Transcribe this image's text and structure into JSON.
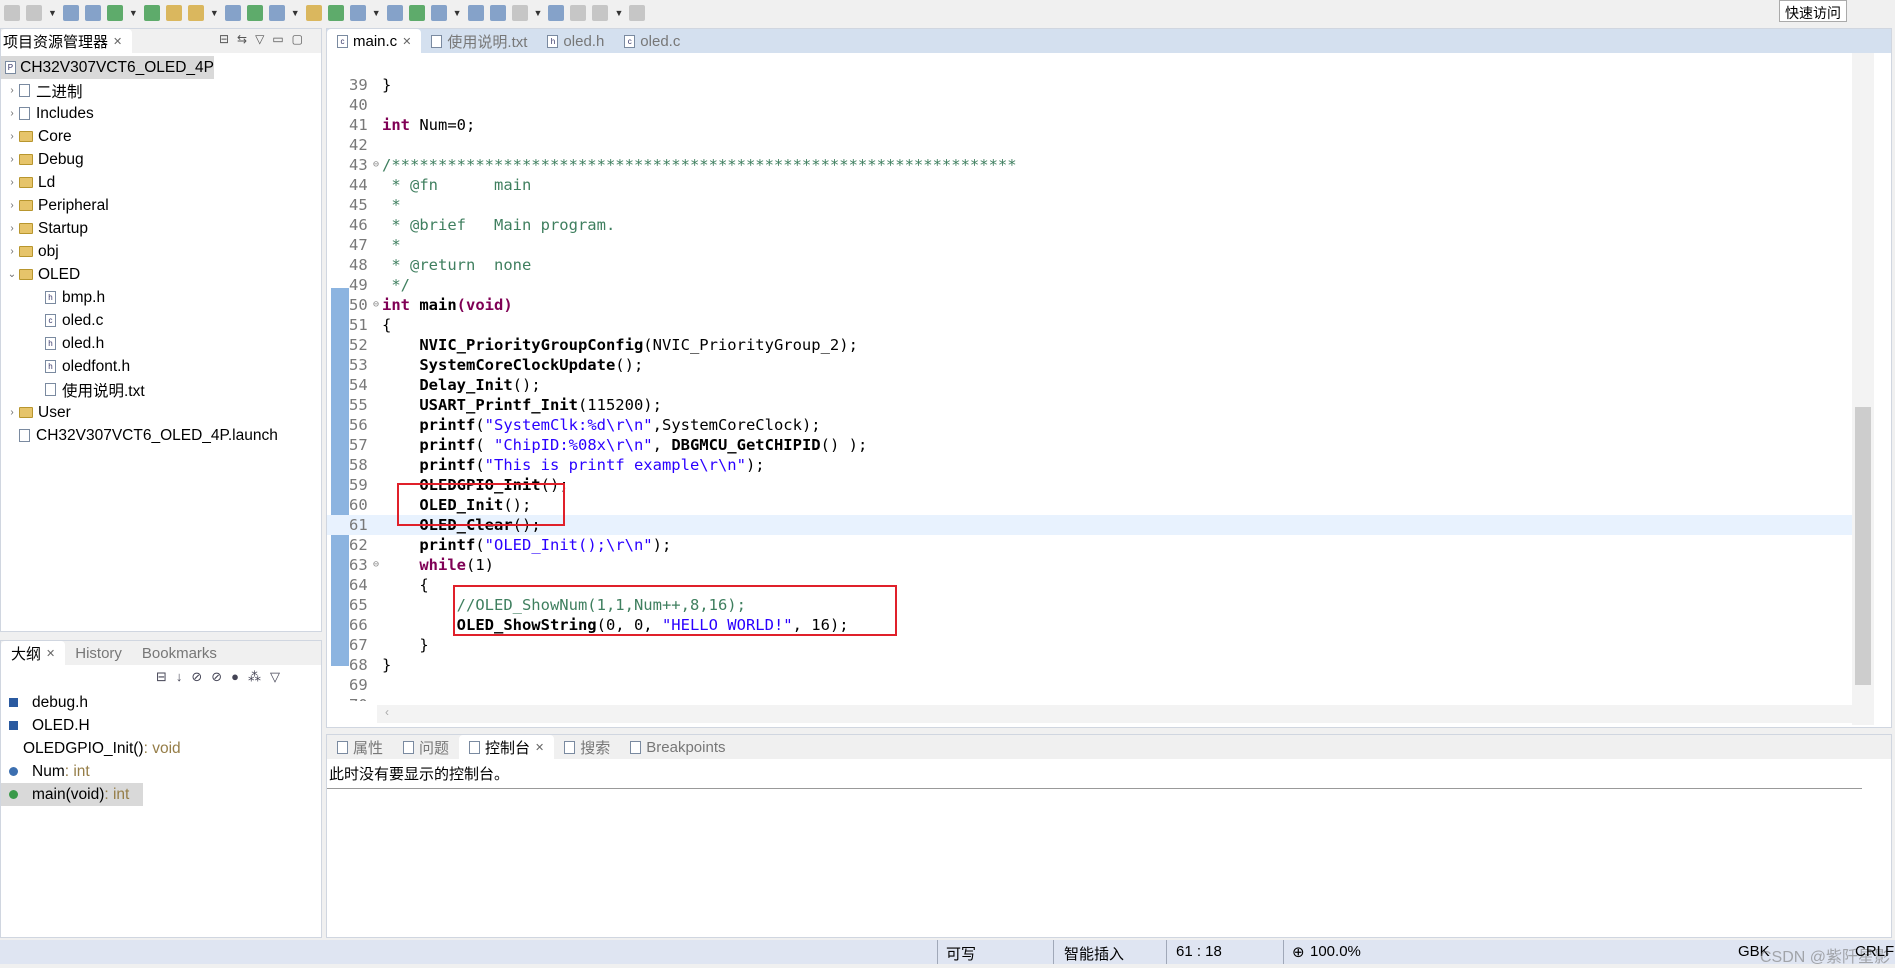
{
  "toolbar": {
    "quick_access": "快速访问"
  },
  "explorer": {
    "title": "项目资源管理器",
    "project": "CH32V307VCT6_OLED_4P",
    "items": [
      {
        "label": "二进制",
        "type": "binary",
        "expandable": true
      },
      {
        "label": "Includes",
        "type": "includes",
        "expandable": true
      },
      {
        "label": "Core",
        "type": "folder",
        "expandable": true
      },
      {
        "label": "Debug",
        "type": "folder",
        "expandable": true
      },
      {
        "label": "Ld",
        "type": "folder",
        "expandable": true
      },
      {
        "label": "Peripheral",
        "type": "folder",
        "expandable": true
      },
      {
        "label": "Startup",
        "type": "folder",
        "expandable": true
      },
      {
        "label": "obj",
        "type": "folder",
        "expandable": true
      },
      {
        "label": "OLED",
        "type": "folder",
        "expanded": true
      },
      {
        "label": "bmp.h",
        "type": "h",
        "child": true
      },
      {
        "label": "oled.c",
        "type": "c",
        "child": true
      },
      {
        "label": "oled.h",
        "type": "h",
        "child": true
      },
      {
        "label": "oledfont.h",
        "type": "h",
        "child": true
      },
      {
        "label": "使用说明.txt",
        "type": "txt",
        "child": true
      },
      {
        "label": "User",
        "type": "folder",
        "expandable": true
      },
      {
        "label": "CH32V307VCT6_OLED_4P.launch",
        "type": "launch"
      }
    ]
  },
  "outline": {
    "tabs": [
      "大纲",
      "History",
      "Bookmarks"
    ],
    "items": [
      {
        "name": "debug.h",
        "type": ""
      },
      {
        "name": "OLED.H",
        "type": ""
      },
      {
        "name": "OLEDGPIO_Init()",
        "type": " : void"
      },
      {
        "name": "Num",
        "type": " : int"
      },
      {
        "name": "main(void)",
        "type": " : int"
      }
    ]
  },
  "editor": {
    "tabs": [
      "main.c",
      "使用说明.txt",
      "oled.h",
      "oled.c"
    ],
    "active_tab": "main.c",
    "lines": [
      {
        "n": "39",
        "t": [
          [
            "",
            "}"
          ]
        ]
      },
      {
        "n": "40",
        "t": []
      },
      {
        "n": "41",
        "t": [
          [
            "kw",
            "int"
          ],
          [
            "",
            " Num=0;"
          ]
        ]
      },
      {
        "n": "42",
        "t": []
      },
      {
        "n": "43",
        "t": [
          [
            "cm",
            "/*******************************************************************"
          ]
        ],
        "fold": true
      },
      {
        "n": "44",
        "t": [
          [
            "cm",
            " * @fn      main"
          ]
        ]
      },
      {
        "n": "45",
        "t": [
          [
            "cm",
            " *"
          ]
        ]
      },
      {
        "n": "46",
        "t": [
          [
            "cm",
            " * @brief   Main program."
          ]
        ]
      },
      {
        "n": "47",
        "t": [
          [
            "cm",
            " *"
          ]
        ]
      },
      {
        "n": "48",
        "t": [
          [
            "cm",
            " * @return  none"
          ]
        ]
      },
      {
        "n": "49",
        "t": [
          [
            "cm",
            " */"
          ]
        ]
      },
      {
        "n": "50",
        "t": [
          [
            "kw",
            "int"
          ],
          [
            "",
            " "
          ],
          [
            "fn",
            "main"
          ],
          [
            "kw",
            "(void)"
          ]
        ],
        "fold": true
      },
      {
        "n": "51",
        "t": [
          [
            "",
            "{"
          ]
        ]
      },
      {
        "n": "52",
        "t": [
          [
            "",
            "    "
          ],
          [
            "fn",
            "NVIC_PriorityGroupConfig"
          ],
          [
            "",
            "(NVIC_PriorityGroup_2);"
          ]
        ]
      },
      {
        "n": "53",
        "t": [
          [
            "",
            "    "
          ],
          [
            "fn",
            "SystemCoreClockUpdate"
          ],
          [
            "",
            "();"
          ]
        ]
      },
      {
        "n": "54",
        "t": [
          [
            "",
            "    "
          ],
          [
            "fn",
            "Delay_Init"
          ],
          [
            "",
            "();"
          ]
        ]
      },
      {
        "n": "55",
        "t": [
          [
            "",
            "    "
          ],
          [
            "fn",
            "USART_Printf_Init"
          ],
          [
            "",
            "(115200);"
          ]
        ]
      },
      {
        "n": "56",
        "t": [
          [
            "",
            "    "
          ],
          [
            "fn",
            "printf"
          ],
          [
            "",
            "("
          ],
          [
            "st",
            "\"SystemClk:%d\\r\\n\""
          ],
          [
            "",
            ",SystemCoreClock);"
          ]
        ]
      },
      {
        "n": "57",
        "t": [
          [
            "",
            "    "
          ],
          [
            "fn",
            "printf"
          ],
          [
            "",
            "( "
          ],
          [
            "st",
            "\"ChipID:%08x\\r\\n\""
          ],
          [
            "",
            ", "
          ],
          [
            "fn",
            "DBGMCU_GetCHIPID"
          ],
          [
            "",
            "() );"
          ]
        ]
      },
      {
        "n": "58",
        "t": [
          [
            "",
            "    "
          ],
          [
            "fn",
            "printf"
          ],
          [
            "",
            "("
          ],
          [
            "st",
            "\"This is printf example\\r\\n\""
          ],
          [
            "",
            ");"
          ]
        ]
      },
      {
        "n": "59",
        "t": [
          [
            "",
            "    "
          ],
          [
            "fn",
            "OLEDGPIO_Init"
          ],
          [
            "",
            "();"
          ]
        ]
      },
      {
        "n": "60",
        "t": [
          [
            "",
            "    "
          ],
          [
            "fn",
            "OLED_Init"
          ],
          [
            "",
            "();"
          ]
        ]
      },
      {
        "n": "61",
        "t": [
          [
            "",
            "    "
          ],
          [
            "fn",
            "OLED_Clear"
          ],
          [
            "",
            "();"
          ]
        ],
        "current": true
      },
      {
        "n": "62",
        "t": [
          [
            "",
            "    "
          ],
          [
            "fn",
            "printf"
          ],
          [
            "",
            "("
          ],
          [
            "st",
            "\"OLED_Init();\\r\\n\""
          ],
          [
            "",
            ");"
          ]
        ]
      },
      {
        "n": "63",
        "t": [
          [
            "",
            "    "
          ],
          [
            "kw",
            "while"
          ],
          [
            "",
            "(1)"
          ]
        ],
        "fold": true
      },
      {
        "n": "64",
        "t": [
          [
            "",
            "    {"
          ]
        ]
      },
      {
        "n": "65",
        "t": [
          [
            "",
            "        "
          ],
          [
            "cm",
            "//OLED_ShowNum(1,1,Num++,8,16);"
          ]
        ]
      },
      {
        "n": "66",
        "t": [
          [
            "",
            "        "
          ],
          [
            "fn",
            "OLED_ShowString"
          ],
          [
            "",
            "(0, 0, "
          ],
          [
            "st",
            "\"HELLO WORLD!\""
          ],
          [
            "",
            ", 16);"
          ]
        ]
      },
      {
        "n": "67",
        "t": [
          [
            "",
            "    }"
          ]
        ]
      },
      {
        "n": "68",
        "t": [
          [
            "",
            "}"
          ]
        ]
      },
      {
        "n": "69",
        "t": []
      },
      {
        "n": "70",
        "t": []
      }
    ]
  },
  "console": {
    "tabs": [
      "属性",
      "问题",
      "控制台",
      "搜索",
      "Breakpoints"
    ],
    "active_tab": "控制台",
    "message": "此时没有要显示的控制台。"
  },
  "status": {
    "writable": "可写",
    "insert_mode": "智能插入",
    "position": "61 : 18",
    "zoom": "100.0%",
    "encoding": "GBK",
    "line_ending": "CRLF",
    "watermark": "CSDN @紫阡星影"
  },
  "colors": {
    "keyword": "#7f0055",
    "comment": "#3f7f5f",
    "string": "#2a00ff",
    "highlight_box": "#e0202a",
    "status_bar": "#dfe5f2"
  }
}
